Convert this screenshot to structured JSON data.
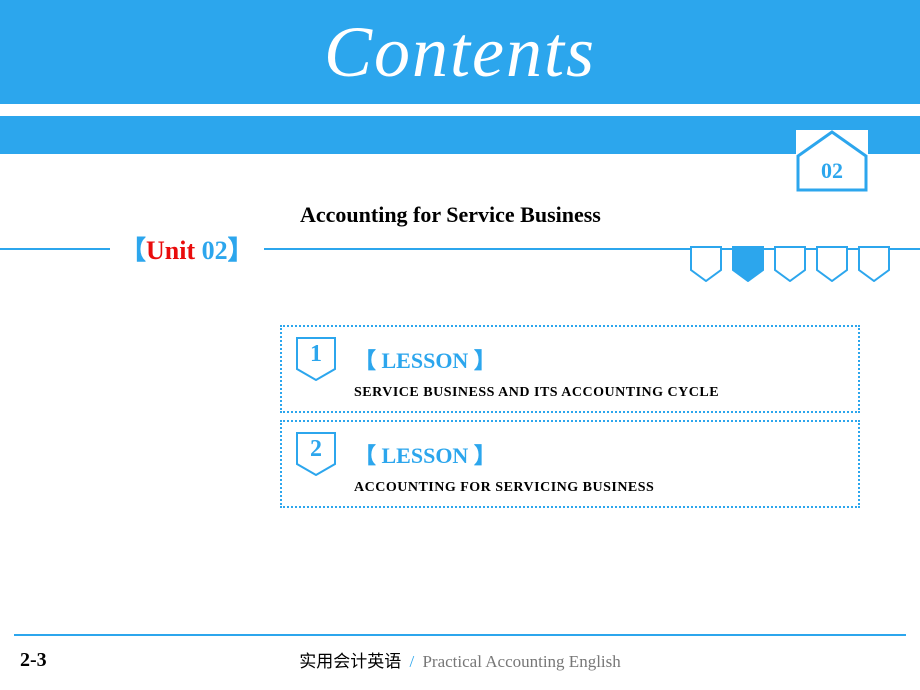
{
  "header": {
    "title": "Contents"
  },
  "page_marker": {
    "number": "02"
  },
  "unit": {
    "bracket_open": "【",
    "bracket_close": "】",
    "word": "Unit",
    "number": "02",
    "section_title": "Accounting for Service Business"
  },
  "tabs": {
    "count": 5,
    "active_index": 1
  },
  "lessons": [
    {
      "number": "1",
      "label": "【 LESSON 】",
      "title": "SERVICE  BUSINESS  AND ITS ACCOUNTING CYCLE"
    },
    {
      "number": "2",
      "label": "【 LESSON 】",
      "title": "ACCOUNTING FOR SERVICING BUSINESS"
    }
  ],
  "footer": {
    "page": "2-3",
    "book_zh": "实用会计英语",
    "sep": "/",
    "book_en": "Practical Accounting English"
  },
  "colors": {
    "accent": "#2ca6ed",
    "unit_red": "#e90c0c"
  }
}
